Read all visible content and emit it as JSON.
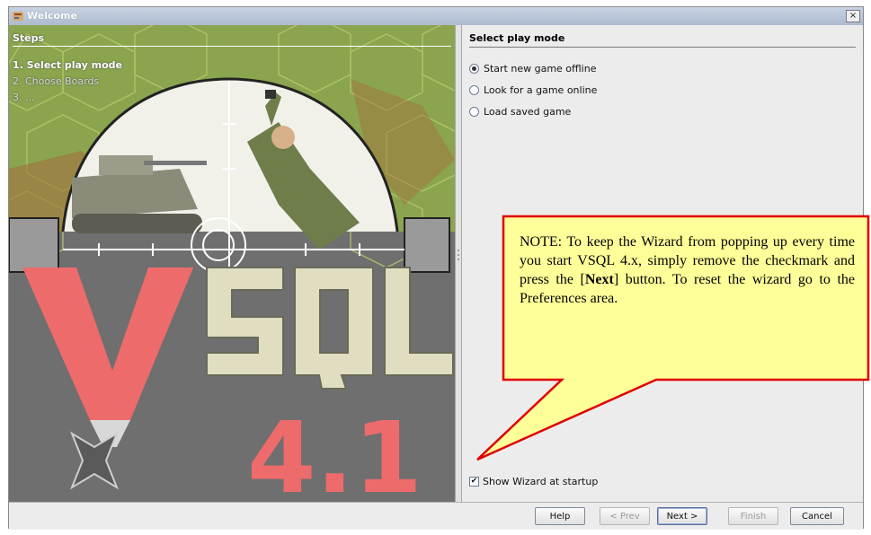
{
  "window": {
    "title": "Welcome",
    "close_glyph": "×"
  },
  "steps": {
    "header": "Steps",
    "items": [
      "1. Select play mode",
      "2. Choose Boards",
      "3. ..."
    ]
  },
  "splash": {
    "logo": "VSQL",
    "version": "4.1"
  },
  "main": {
    "title": "Select play mode",
    "options": [
      "Start new game offline",
      "Look for a game online",
      "Load saved game"
    ],
    "selected_option": "Start new game offline",
    "show_wizard_label": "Show Wizard at startup",
    "show_wizard_checked": true,
    "check_glyph": "✔"
  },
  "buttons": {
    "help": "Help",
    "prev": "< Prev",
    "next": "Next >",
    "finish": "Finish",
    "cancel": "Cancel"
  },
  "callout": {
    "text_before": "NOTE:  To keep the Wizard from popping up every time you start VSQL 4.x, simply remove the checkmark and press the [",
    "bold": "Next",
    "text_after": "] button.  To reset the wizard go to the Preferences area.",
    "fill_color": "#ffff99",
    "border_color": "#e00000"
  },
  "colors": {
    "logo_red": "#ee6b6b",
    "logo_beige": "#e0ddc0",
    "map_green": "#8aa54e"
  }
}
